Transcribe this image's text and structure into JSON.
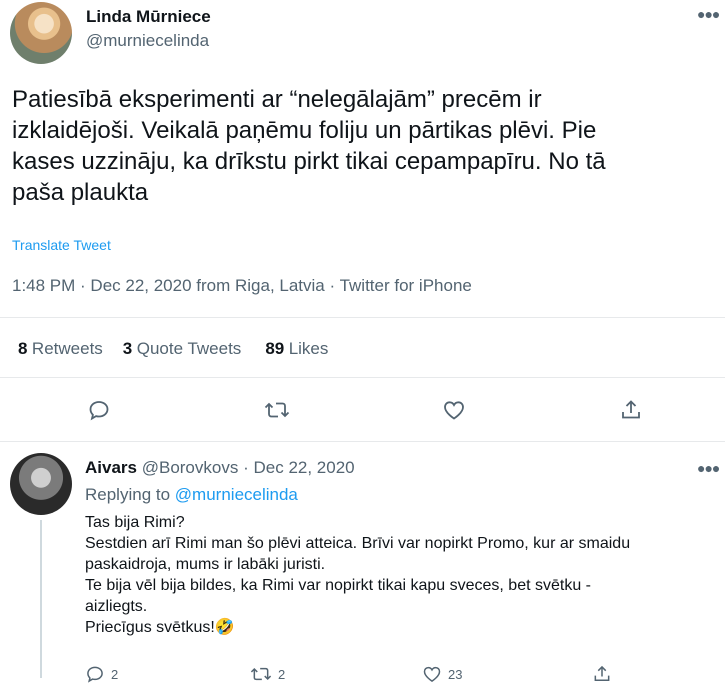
{
  "main_tweet": {
    "author_name": "Linda Mūrniece",
    "author_handle": "@murniecelinda",
    "text_lines": [
      "Patiesībā eksperimenti ar “nelegālajām” precēm ir",
      "izklaidējoši. Veikalā paņēmu foliju un pārtikas plēvi. Pie",
      "kases uzzināju, ka drīkstu pirkt tikai cepampapīru. No tā",
      "paša plaukta"
    ],
    "translate_label": "Translate Tweet",
    "timestamp_line": "1:48 PM · Dec 22, 2020 from Riga, Latvia · Twitter for iPhone",
    "stats": {
      "retweets_count": "8",
      "retweets_label": "Retweets",
      "quotes_count": "3",
      "quotes_label": "Quote Tweets",
      "likes_count": "89",
      "likes_label": "Likes"
    }
  },
  "reply": {
    "author_name": "Aivars",
    "author_handle": "@Borovkovs",
    "dot": "·",
    "date": "Dec 22, 2020",
    "replying_prefix": "Replying to",
    "replying_handle": "@murniecelinda",
    "text_lines": [
      "Tas bija Rimi?",
      "Sestdien arī Rimi man šo plēvi atteica. Brīvi var nopirkt Promo, kur ar smaidu",
      "paskaidroja, mums ir labāki juristi.",
      "Te bija vēl bija bildes, ka Rimi var nopirkt tikai kapu sveces, bet svētku -",
      "aizliegts.",
      "Priecīgus svētkus!🤣"
    ],
    "reply_count": "2",
    "retweet_count": "2",
    "like_count": "23"
  },
  "icons": {
    "more": "more-icon",
    "reply": "reply-icon",
    "retweet": "retweet-icon",
    "like": "like-icon",
    "share": "share-icon"
  },
  "colors": {
    "link": "#1d9bf0",
    "secondary_text": "#536471",
    "divider": "#e7e9eb"
  }
}
